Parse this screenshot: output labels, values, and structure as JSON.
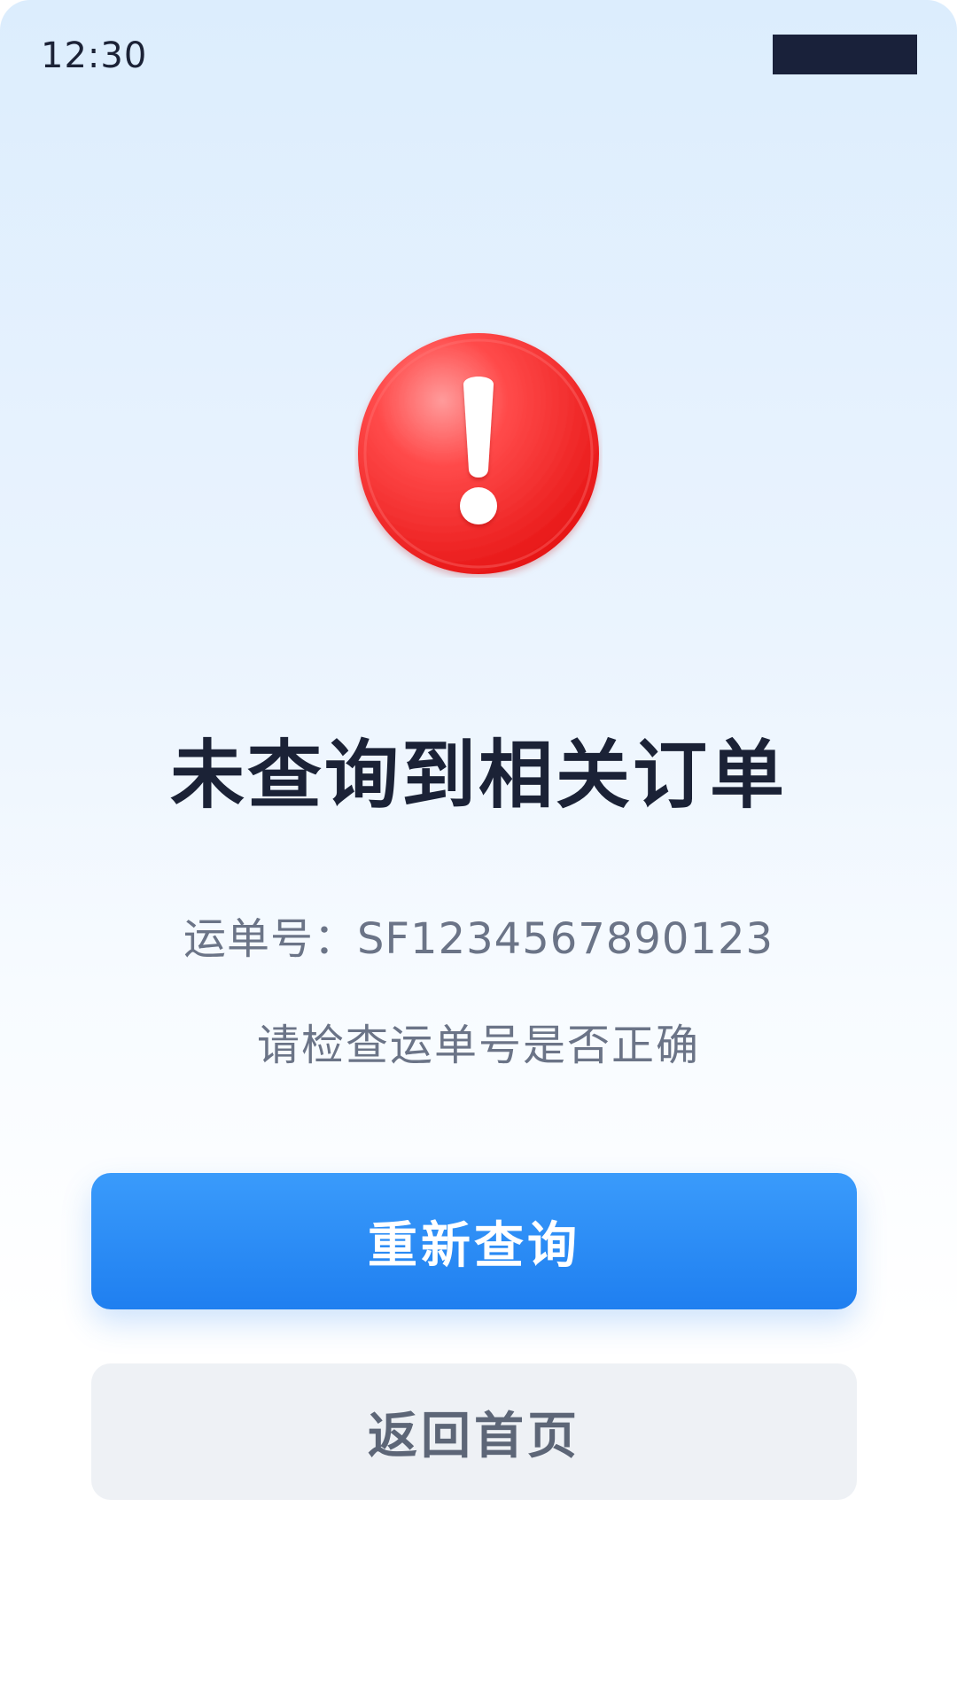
{
  "status_bar": {
    "time": "12:30"
  },
  "alert": {
    "icon": "exclamation-icon",
    "color": "#ff2f2f"
  },
  "message": {
    "title": "未查询到相关订单",
    "tracking_line": "运单号：SF1234567890123",
    "hint": "请检查运单号是否正确"
  },
  "actions": {
    "retry_label": "重新查询",
    "home_label": "返回首页"
  },
  "colors": {
    "primary": "#2a8cf6",
    "secondary_bg": "#eef1f5",
    "title_text": "#1b2236",
    "muted_text": "#6b7487"
  }
}
